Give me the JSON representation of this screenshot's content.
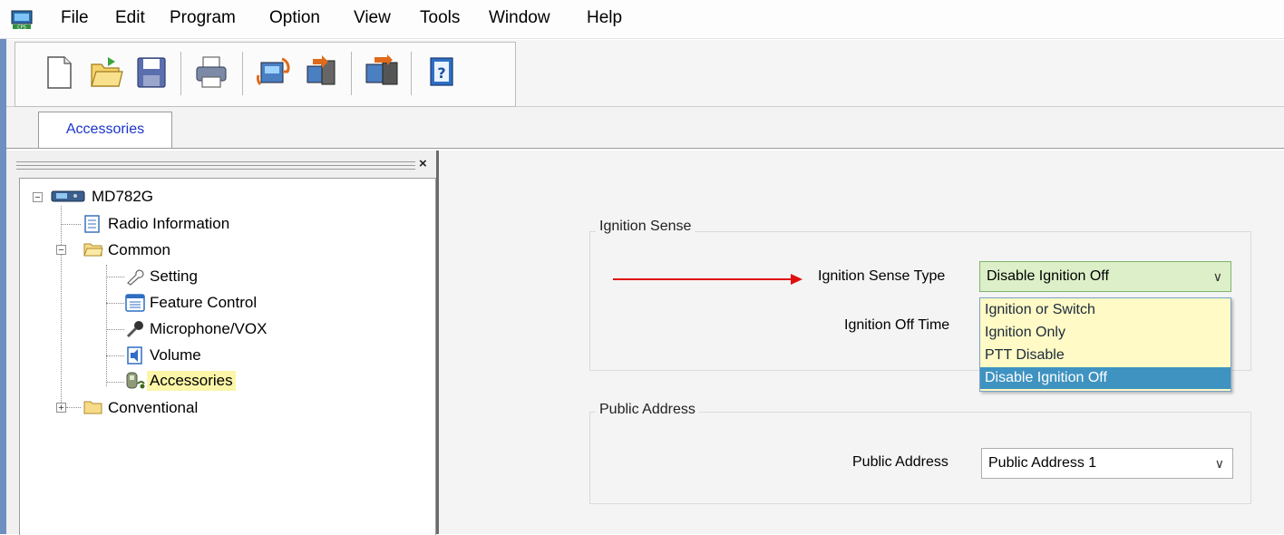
{
  "menu": [
    "File",
    "Edit",
    "Program",
    "Option",
    "View",
    "Tools",
    "Window",
    "Help"
  ],
  "tabs": {
    "active": "Accessories"
  },
  "tree": {
    "root": "MD782G",
    "radio_information": "Radio Information",
    "common": "Common",
    "setting": "Setting",
    "feature_control": "Feature Control",
    "microphone_vox": "Microphone/VOX",
    "volume": "Volume",
    "accessories": "Accessories",
    "conventional": "Conventional",
    "close": "×"
  },
  "ignition": {
    "group_label": "Ignition Sense",
    "type_label": "Ignition Sense Type",
    "type_value": "Disable Ignition Off",
    "off_time_label": "Ignition Off Time",
    "options": [
      "Ignition or Switch",
      "Ignition Only",
      "PTT Disable",
      "Disable Ignition Off"
    ],
    "highlighted_option": "Disable Ignition Off"
  },
  "public_address": {
    "group_label": "Public Address",
    "label": "Public Address",
    "value": "Public Address 1"
  },
  "colors": {
    "accent_arrow": "#e01010",
    "selection_highlight": "#3f93c1",
    "dropdown_bg": "#fffac6",
    "tree_selected": "#fbf6a8"
  },
  "icons": [
    "app-icon",
    "new-file-icon",
    "open-folder-icon",
    "save-icon",
    "print-icon",
    "read-radio-icon",
    "write-radio-icon",
    "clone-icon",
    "help-icon"
  ]
}
